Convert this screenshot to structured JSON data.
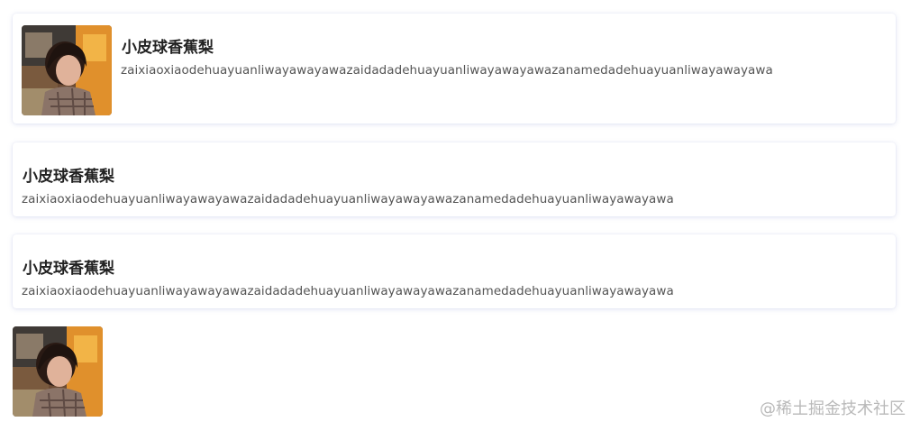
{
  "cards": [
    {
      "has_image": true,
      "image_alt": "avatar photo",
      "title": "小皮球香蕉梨",
      "description": "zaixiaoxiaodehuayuanliwayawayawazaidadadehuayuanliwayawayawazanamedadehuayuanliwayawayawa"
    },
    {
      "has_image": false,
      "title": "小皮球香蕉梨",
      "description": "zaixiaoxiaodehuayuanliwayawayawazaidadadehuayuanliwayawayawazanamedadehuayuanliwayawayawa"
    },
    {
      "has_image": false,
      "title": "小皮球香蕉梨",
      "description": "zaixiaoxiaodehuayuanliwayawayawazaidadadehuayuanliwayawayawazanamedadehuayuanliwayawayawa"
    }
  ],
  "standalone_image": {
    "image_alt": "avatar photo"
  },
  "watermark": "@稀土掘金技术社区",
  "colors": {
    "card_shadow": "#7882c8",
    "title": "#222222",
    "description": "#555555",
    "watermark": "#b9b9b9"
  }
}
